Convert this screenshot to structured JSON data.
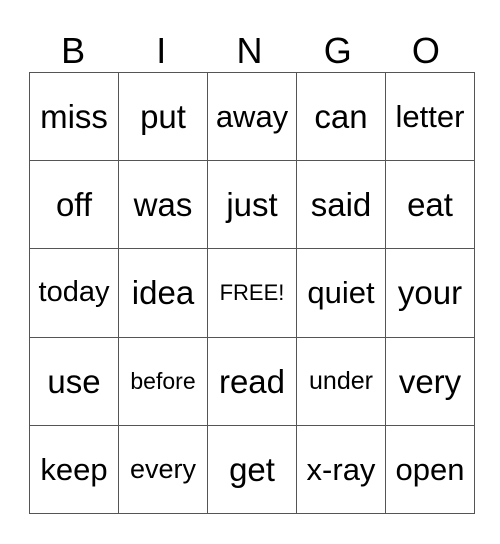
{
  "header": {
    "letters": [
      "B",
      "I",
      "N",
      "G",
      "O"
    ]
  },
  "card": {
    "rows": [
      [
        "miss",
        "put",
        "away",
        "can",
        "letter"
      ],
      [
        "off",
        "was",
        "just",
        "said",
        "eat"
      ],
      [
        "today",
        "idea",
        "FREE!",
        "quiet",
        "your"
      ],
      [
        "use",
        "before",
        "read",
        "under",
        "very"
      ],
      [
        "keep",
        "every",
        "get",
        "x-ray",
        "open"
      ]
    ]
  }
}
